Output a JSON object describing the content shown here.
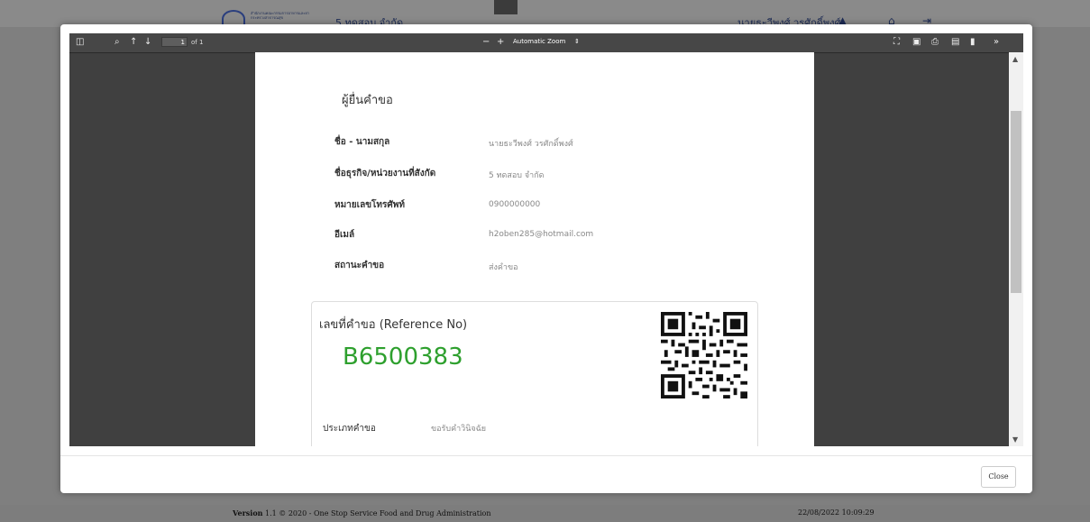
{
  "topbar": {
    "logo_text_line1": "สำนักงานคณะกรรมการอาหารและยา",
    "logo_text_line2": "กระทรวงสาธารณสุข",
    "org_name": "5 ทดสอบ จำกัด",
    "user_name": "นายธะวีพงศ์ วรศักดิ์พงศ์"
  },
  "viewer": {
    "page_number": "1",
    "page_total": "of 1",
    "zoom_minus": "−",
    "zoom_plus": "+",
    "zoom_level": "Automatic Zoom",
    "zoom_caret": "⇕"
  },
  "document": {
    "section_title": "ผู้ยื่นคำขอ",
    "fields": [
      {
        "label": "ชื่อ - นามสกุล",
        "value": "นายธะวีพงศ์ วรศักดิ์พงศ์"
      },
      {
        "label": "ชื่อธุรกิจ/หน่วยงานที่สังกัด",
        "value": "5 ทดสอบ จำกัด"
      },
      {
        "label": "หมายเลขโทรศัพท์",
        "value": "0900000000"
      },
      {
        "label": "อีเมล์",
        "value": "h2oben285@hotmail.com"
      },
      {
        "label": "สถานะคำขอ",
        "value": "ส่งคำขอ"
      }
    ],
    "reference_label": "เลขที่คำขอ (Reference No)",
    "reference_number": "B6500383",
    "request_type_label": "ประเภทคำขอ",
    "request_type_value": "ขอรับคำวินิจฉัย"
  },
  "modal": {
    "close_label": "Close"
  },
  "footer": {
    "version_bold": "Version",
    "version_text": "1.1 © 2020 - One Stop Service Food and Drug Administration",
    "datetime": "22/08/2022 10:09:29"
  },
  "colors": {
    "reference_green": "#2ea02e",
    "viewer_bg": "#404040",
    "toolbar_bg": "#474747"
  }
}
